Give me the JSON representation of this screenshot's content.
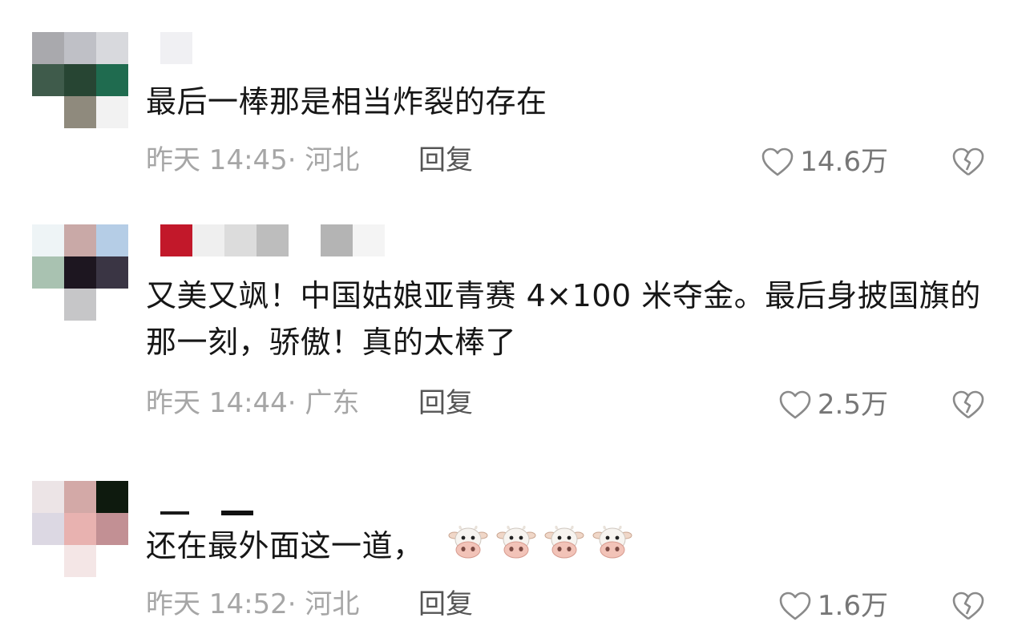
{
  "comments": [
    {
      "text": "最后一棒那是相当炸裂的存在",
      "meta": "昨天 14:45· 河北",
      "reply_label": "回复",
      "likes": "14.6万"
    },
    {
      "text": "又美又飒！中国姑娘亚青赛 4×100 米夺金。最后身披国旗的那一刻，骄傲！真的太棒了",
      "meta": "昨天 14:44· 广东",
      "reply_label": "回复",
      "likes": "2.5万"
    },
    {
      "text": "还在最外面这一道，",
      "emoji": [
        "cow-face",
        "cow-face",
        "cow-face",
        "cow-face"
      ],
      "meta": "昨天 14:52· 河北",
      "reply_label": "回复",
      "likes": "1.6万"
    }
  ],
  "icons": {
    "like": "heart-outline-icon",
    "dislike": "broken-heart-icon"
  },
  "colors": {
    "text": "#161616",
    "meta": "#a6a6a6",
    "reply": "#555555",
    "like": "#777777"
  }
}
